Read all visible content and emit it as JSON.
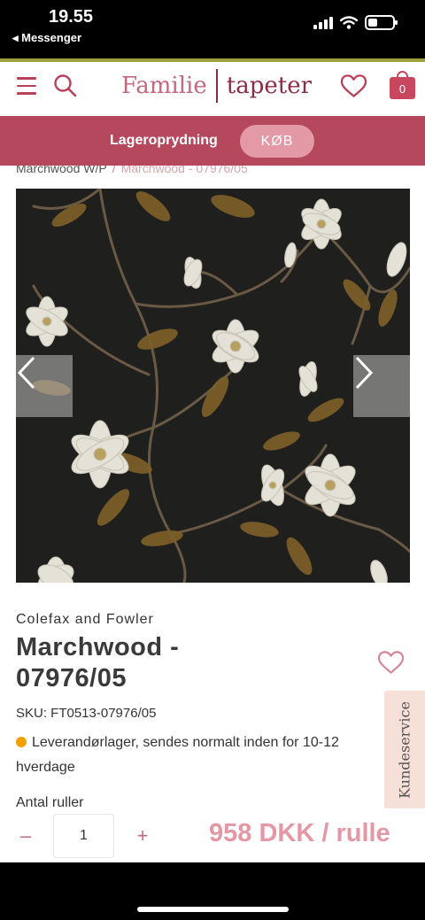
{
  "status_bar": {
    "time": "19.55",
    "back_app": "Messenger"
  },
  "header": {
    "logo_part1": "Familie",
    "logo_part2": "tapeter",
    "cart_count": "0",
    "icons": [
      "menu-icon",
      "search-icon",
      "heart-icon",
      "shopping-bag-icon"
    ]
  },
  "promo": {
    "text": "Lageroprydning",
    "button": "KØB"
  },
  "breadcrumb": {
    "parent": "Marchwood W/P",
    "separator": "/",
    "current": "Marchwood - 07976/05"
  },
  "gallery": {
    "prev_icon": "chevron-left-icon",
    "next_icon": "chevron-right-icon"
  },
  "product": {
    "brand": "Colefax and Fowler",
    "title": "Marchwood - 07976/05",
    "sku": "SKU: FT0513-07976/05",
    "stock": "Leverandørlager, sendes normalt inden for 10-12 hverdage",
    "quantity_label": "Antal ruller",
    "quantity": "1",
    "minus": "–",
    "plus": "+",
    "price": "958 DKK / rulle"
  },
  "side_tab": {
    "label": "Kundeservice"
  },
  "colors": {
    "accent": "#b6485d",
    "logo": "#c2697f",
    "price": "#e497a5",
    "promo_button": "#e49aa6",
    "stock_dot": "#f0a300",
    "status_line": "#9aa13a"
  }
}
